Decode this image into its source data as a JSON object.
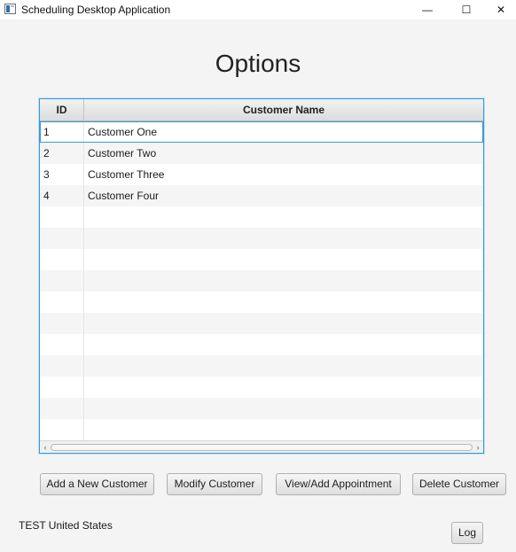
{
  "window": {
    "title": "Scheduling Desktop Application",
    "minimize_glyph": "—",
    "maximize_glyph": "☐",
    "close_glyph": "✕"
  },
  "page": {
    "title": "Options"
  },
  "table": {
    "columns": [
      "ID",
      "Customer Name"
    ],
    "rows": [
      {
        "id": "1",
        "name": "Customer One"
      },
      {
        "id": "2",
        "name": "Customer Two"
      },
      {
        "id": "3",
        "name": "Customer Three"
      },
      {
        "id": "4",
        "name": "Customer Four"
      }
    ],
    "empty_rows": 11,
    "scroll_left_glyph": "‹",
    "scroll_right_glyph": "›"
  },
  "actions": {
    "add": "Add a New Customer",
    "modify": "Modify Customer",
    "view_add_appointment": "View/Add Appointment",
    "delete": "Delete Customer",
    "log": "Log"
  },
  "status": {
    "locale": "TEST United States"
  },
  "colors": {
    "accent": "#3a9bd6",
    "background": "#f4f4f4",
    "row_alt": "#f5f5f5"
  }
}
